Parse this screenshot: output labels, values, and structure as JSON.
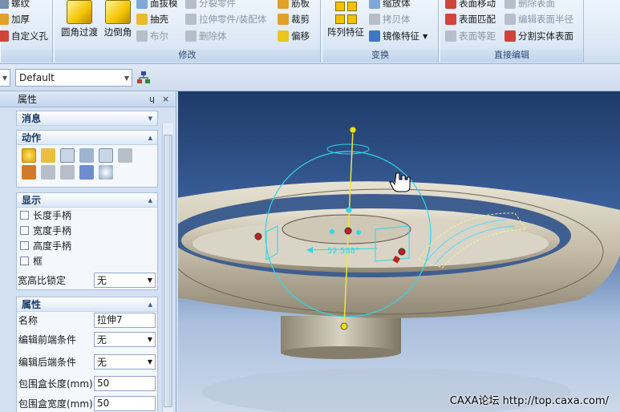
{
  "ribbon": {
    "groups": [
      {
        "label": ""
      },
      {
        "label": "修改"
      },
      {
        "label": "变换"
      },
      {
        "label": "直接编辑"
      }
    ],
    "g0_items": [
      "螺纹",
      "加厚",
      "自定义孔"
    ],
    "round_label": "圆角过渡",
    "chamfer_label": "边倒角",
    "g1_col1": [
      "面拔模",
      "抽壳",
      "布尔"
    ],
    "g1_col2": [
      "分裂零件",
      "拉伸零件/装配体",
      "删除体"
    ],
    "g1_col3": [
      "筋板",
      "裁剪",
      "偏移"
    ],
    "array_label": "阵列特征",
    "g2_items": [
      "缩放体",
      "拷贝体",
      "镜像特征"
    ],
    "g3_col1": [
      "表面移动",
      "表面匹配",
      "表面等距"
    ],
    "g3_col2": [
      "删除表面",
      "编辑表面半径",
      "分割实体表面"
    ]
  },
  "toolbar": {
    "combo_value": "Default"
  },
  "panel": {
    "title": "属性",
    "pin": "ɥ",
    "close": "×",
    "messages": "消息",
    "actions": "动作",
    "display": {
      "header": "显示",
      "checks": [
        "长度手柄",
        "宽度手柄",
        "高度手柄",
        "框"
      ],
      "aspect_label": "宽高比锁定",
      "aspect_value": "无"
    },
    "props": {
      "header": "属性",
      "name_label": "名称",
      "name_value": "拉伸7",
      "pre_label": "编辑前端条件",
      "pre_value": "无",
      "post_label": "编辑后端条件",
      "post_value": "无",
      "len_label": "包围盒长度(mm)",
      "len_value": "50",
      "wid_label": "包围盒宽度(mm)",
      "wid_value": "50"
    }
  },
  "viewport": {
    "angle_label": "52.588°",
    "watermark": "CAXA论坛 http://top.caxa.com/"
  }
}
